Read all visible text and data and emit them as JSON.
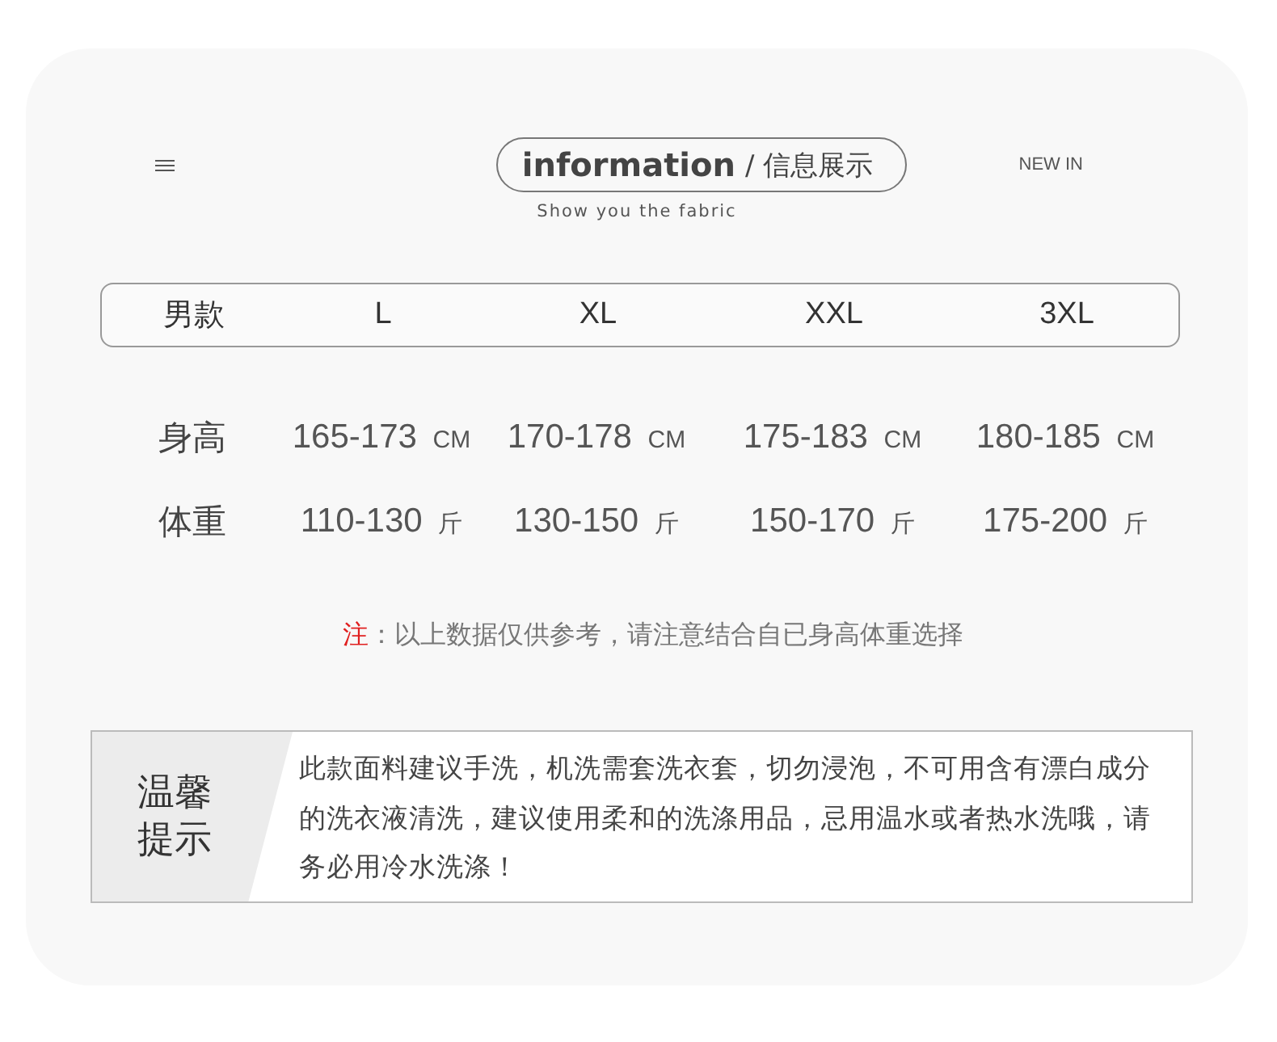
{
  "header": {
    "title": "information",
    "title_cn": "/ 信息展示",
    "subtitle": "Show you the fabric",
    "link": "NEW IN"
  },
  "table": {
    "columns": [
      "男款",
      "L",
      "XL",
      "XXL",
      "3XL"
    ],
    "rows": [
      {
        "cells": [
          {
            "value": "身高"
          },
          {
            "value": "165-173",
            "unit": "CM"
          },
          {
            "value": "170-178",
            "unit": "CM"
          },
          {
            "value": "175-183",
            "unit": "CM"
          },
          {
            "value": "180-185",
            "unit": "CM"
          }
        ]
      },
      {
        "cells": [
          {
            "value": "体重"
          },
          {
            "value": "110-130",
            "unit": "斤"
          },
          {
            "value": "130-150",
            "unit": "斤"
          },
          {
            "value": "150-170",
            "unit": "斤"
          },
          {
            "value": "175-200",
            "unit": "斤"
          }
        ]
      }
    ]
  },
  "note": {
    "mark": "注",
    "text": "：以上数据仅供参考，请注意结合自已身高体重选择"
  },
  "tip": {
    "title": "温馨提示",
    "text": "此款面料建议手洗，机洗需套洗衣套，切勿浸泡，不可用含有漂白成分的洗衣液清洗，建议使用柔和的洗涤用品，忌用温水或者热水洗哦，请务必用冷水洗涤！"
  }
}
